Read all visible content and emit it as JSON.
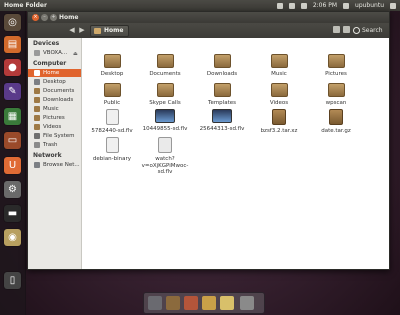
{
  "panel": {
    "title": "Home Folder",
    "clock": "2:06 PM",
    "user": "upubuntu"
  },
  "window": {
    "title": "Home",
    "close_glyph": "×",
    "min_glyph": "–",
    "max_glyph": "+"
  },
  "toolbar": {
    "breadcrumb": "Home",
    "search_label": "Search"
  },
  "sidebar": {
    "devices_header": "Devices",
    "devices": [
      {
        "label": "VBOXA..."
      }
    ],
    "computer_header": "Computer",
    "computer": [
      {
        "label": "Home",
        "icon": "home-icon",
        "color": "#ffffff"
      },
      {
        "label": "Desktop",
        "icon": "desktop-icon",
        "color": "#7c7f84"
      },
      {
        "label": "Documents",
        "icon": "documents-icon",
        "color": "#9f7a46"
      },
      {
        "label": "Downloads",
        "icon": "downloads-icon",
        "color": "#9f7a46"
      },
      {
        "label": "Music",
        "icon": "music-icon",
        "color": "#9f7a46"
      },
      {
        "label": "Pictures",
        "icon": "pictures-icon",
        "color": "#9f7a46"
      },
      {
        "label": "Videos",
        "icon": "videos-icon",
        "color": "#9f7a46"
      },
      {
        "label": "File System",
        "icon": "drive-icon",
        "color": "#6f6f6f"
      },
      {
        "label": "Trash",
        "icon": "trash-icon",
        "color": "#8a8a8a"
      }
    ],
    "network_header": "Network",
    "network": [
      {
        "label": "Browse Net..."
      }
    ]
  },
  "files": [
    {
      "label": "Desktop",
      "type": "folder"
    },
    {
      "label": "Documents",
      "type": "folder"
    },
    {
      "label": "Downloads",
      "type": "folder"
    },
    {
      "label": "Music",
      "type": "folder"
    },
    {
      "label": "Pictures",
      "type": "folder"
    },
    {
      "label": "Public",
      "type": "folder"
    },
    {
      "label": "Skype Calls",
      "type": "folder"
    },
    {
      "label": "Templates",
      "type": "folder"
    },
    {
      "label": "Videos",
      "type": "folder"
    },
    {
      "label": "wpscan",
      "type": "folder"
    },
    {
      "label": "5782440-sd.flv",
      "type": "doc"
    },
    {
      "label": "10449855-sd.flv",
      "type": "video"
    },
    {
      "label": "25644313-sd.flv",
      "type": "video"
    },
    {
      "label": "bzsf3.2.tar.xz",
      "type": "archive"
    },
    {
      "label": "date.tar.gz",
      "type": "archive"
    },
    {
      "label": "debian-binary",
      "type": "doc"
    },
    {
      "label": "watch?v=oXjKGPiMwoc-sd.flv",
      "type": "sound"
    }
  ],
  "colors": {
    "accent": "#e0642d",
    "titlebar": "#3b3a36",
    "launcher_bg": "#1e161c"
  }
}
